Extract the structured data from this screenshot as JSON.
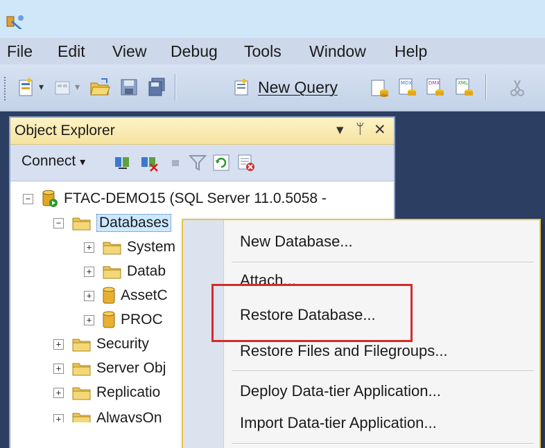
{
  "menubar": {
    "items": [
      "File",
      "Edit",
      "View",
      "Debug",
      "Tools",
      "Window",
      "Help"
    ]
  },
  "toolbar": {
    "new_query_label": "New Query"
  },
  "object_explorer": {
    "title": "Object Explorer",
    "controls": {
      "dropdown": "▾",
      "pin": "ᛘ",
      "close": "✕"
    },
    "connect_label": "Connect",
    "connect_arrow": "▾",
    "tree": {
      "server": "FTAC-DEMO15 (SQL Server 11.0.5058 -",
      "databases": "Databases",
      "children": [
        "System",
        "Datab",
        "AssetC",
        "PROC"
      ],
      "siblings": [
        "Security",
        "Server Obj",
        "Replicatio",
        "AlwaysOn"
      ]
    }
  },
  "context_menu": {
    "items": [
      "New Database...",
      "Attach...",
      "Restore Database...",
      "Restore Files and Filegroups...",
      "Deploy Data-tier Application...",
      "Import Data-tier Application..."
    ]
  },
  "colors": {
    "highlight_box": "#d42a2a",
    "selection": "#cce8ff",
    "panel_header": "#f6e39f",
    "background": "#2c3f62"
  }
}
